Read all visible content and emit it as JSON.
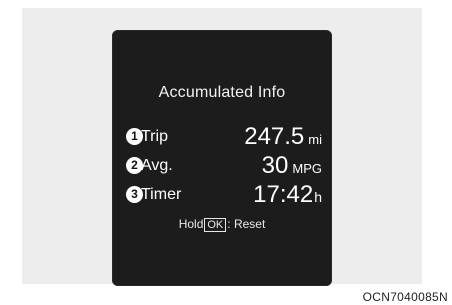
{
  "display": {
    "title": "Accumulated Info",
    "rows": [
      {
        "index": "1",
        "label": "Trip",
        "value": "247.5",
        "unit": "mi"
      },
      {
        "index": "2",
        "label": "Avg.",
        "value": "30",
        "unit": "MPG"
      },
      {
        "index": "3",
        "label": "Timer",
        "value": "17:42",
        "unit": "h"
      }
    ],
    "hint": {
      "prefix": "Hold",
      "key": "OK",
      "suffix": ": Reset"
    }
  },
  "caption": "OCN7040085N",
  "colors": {
    "screen": "#1c1c1c",
    "panel": "#ededed",
    "text": "#ffffff"
  }
}
